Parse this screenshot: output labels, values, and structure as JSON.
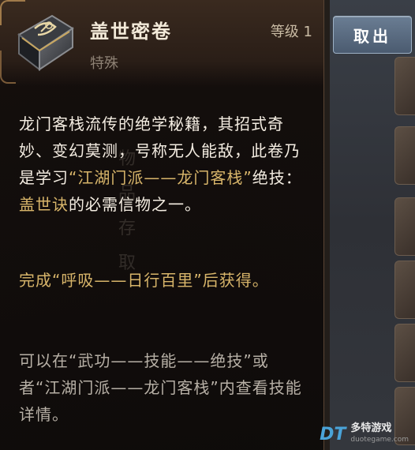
{
  "item": {
    "name": "盖世密卷",
    "level": "等级 1",
    "type": "特殊",
    "icon": "scroll-book-icon"
  },
  "description": {
    "part1": "龙门客栈流传的绝学秘籍，其招式奇妙、变幻莫测，号称无人能敌，此卷乃是学习",
    "highlight1": "“江湖门派——龙门客栈”",
    "part2": "绝技：",
    "highlight2": "盖世诀",
    "part3": "的必需信物之一。"
  },
  "source": "完成“呼吸——日行百里”后获得。",
  "hint": "可以在“武功——技能——绝技”或者“江湖门派——龙门客栈”内查看技能详情。",
  "button": {
    "take_out": "取出"
  },
  "background_faded": [
    "物",
    "品",
    "存",
    "取"
  ],
  "watermark": {
    "cn": "多特游戏",
    "url": "duotegame.com",
    "mark": "DT"
  },
  "colors": {
    "highlight": "#d8b56a",
    "text": "#f4ede2",
    "hint": "#b7b0a6",
    "button": "#5b6d82"
  }
}
